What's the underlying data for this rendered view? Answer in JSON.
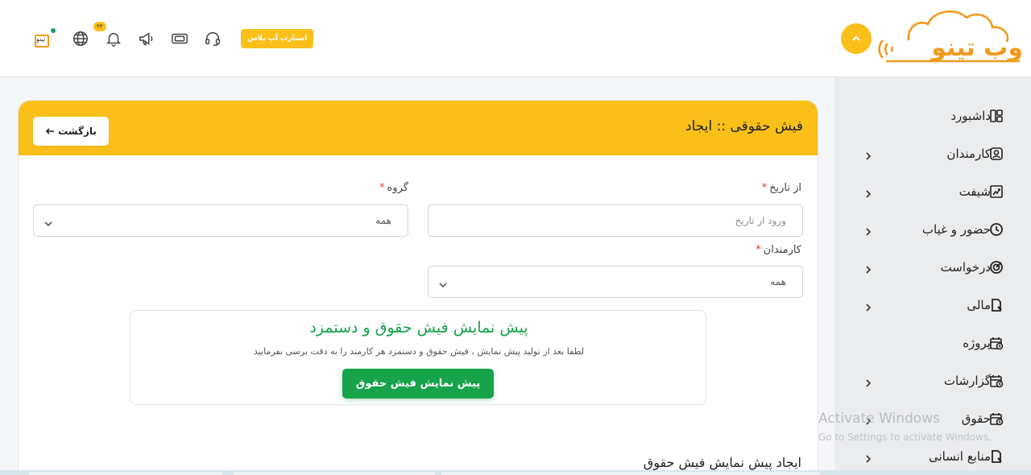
{
  "header": {
    "upgrade_label": "استارت آپ پلاس",
    "notification_count": "۳۳",
    "mini_logo_text": "تینو",
    "icons": [
      "mini-logo-icon",
      "globe-icon",
      "bell-icon",
      "megaphone-icon",
      "ticket-icon",
      "headset-icon"
    ]
  },
  "brand": {
    "logo_text": "وب تینو",
    "accent": "#fbbf1a",
    "logo_color": "#f29a1d",
    "success": "#16a34a"
  },
  "sidebar": {
    "items": [
      {
        "label": "داشبورد",
        "icon": "dashboard-icon",
        "has_children": false
      },
      {
        "label": "کارمندان",
        "icon": "user-icon",
        "has_children": true
      },
      {
        "label": "شیفت",
        "icon": "shift-icon",
        "has_children": true
      },
      {
        "label": "حضور و غیاب",
        "icon": "clock-icon",
        "has_children": true
      },
      {
        "label": "درخواست",
        "icon": "target-icon",
        "has_children": true
      },
      {
        "label": "مالی",
        "icon": "document-icon",
        "has_children": true
      },
      {
        "label": "پروژه",
        "icon": "calendar-icon",
        "has_children": false
      },
      {
        "label": "گزارشات",
        "icon": "calendar-icon",
        "has_children": true
      },
      {
        "label": "حقوق",
        "icon": "calendar-icon",
        "has_children": true
      },
      {
        "label": "منابع انسانی",
        "icon": "document-icon",
        "has_children": true
      }
    ]
  },
  "page": {
    "title": "فیش حقوقی :: ایجاد",
    "back_label": "بازگشت"
  },
  "form": {
    "from_date": {
      "label": "از تاریخ",
      "required": "*",
      "placeholder": "ورود از تاریخ",
      "value": ""
    },
    "group": {
      "label": "گروه",
      "required": "*",
      "value": "همه"
    },
    "employees": {
      "label": "کارمندان",
      "required": "*",
      "value": "همه"
    }
  },
  "preview": {
    "title": "پیش نمایش فیش حقوق و دستمزد",
    "subtitle": "لطفا بعد از تولید پیش نمایش ، فیش حقوق و دستمزد هر کارمند را به دقت برسی بفرمایید",
    "button_label": "پیش نمایش فیش حقوق"
  },
  "section": {
    "title": "ایجاد پیش نمایش فیش حقوق"
  },
  "watermark": {
    "line1": "Activate Windows",
    "line2": "Go to Settings to activate Windows."
  }
}
